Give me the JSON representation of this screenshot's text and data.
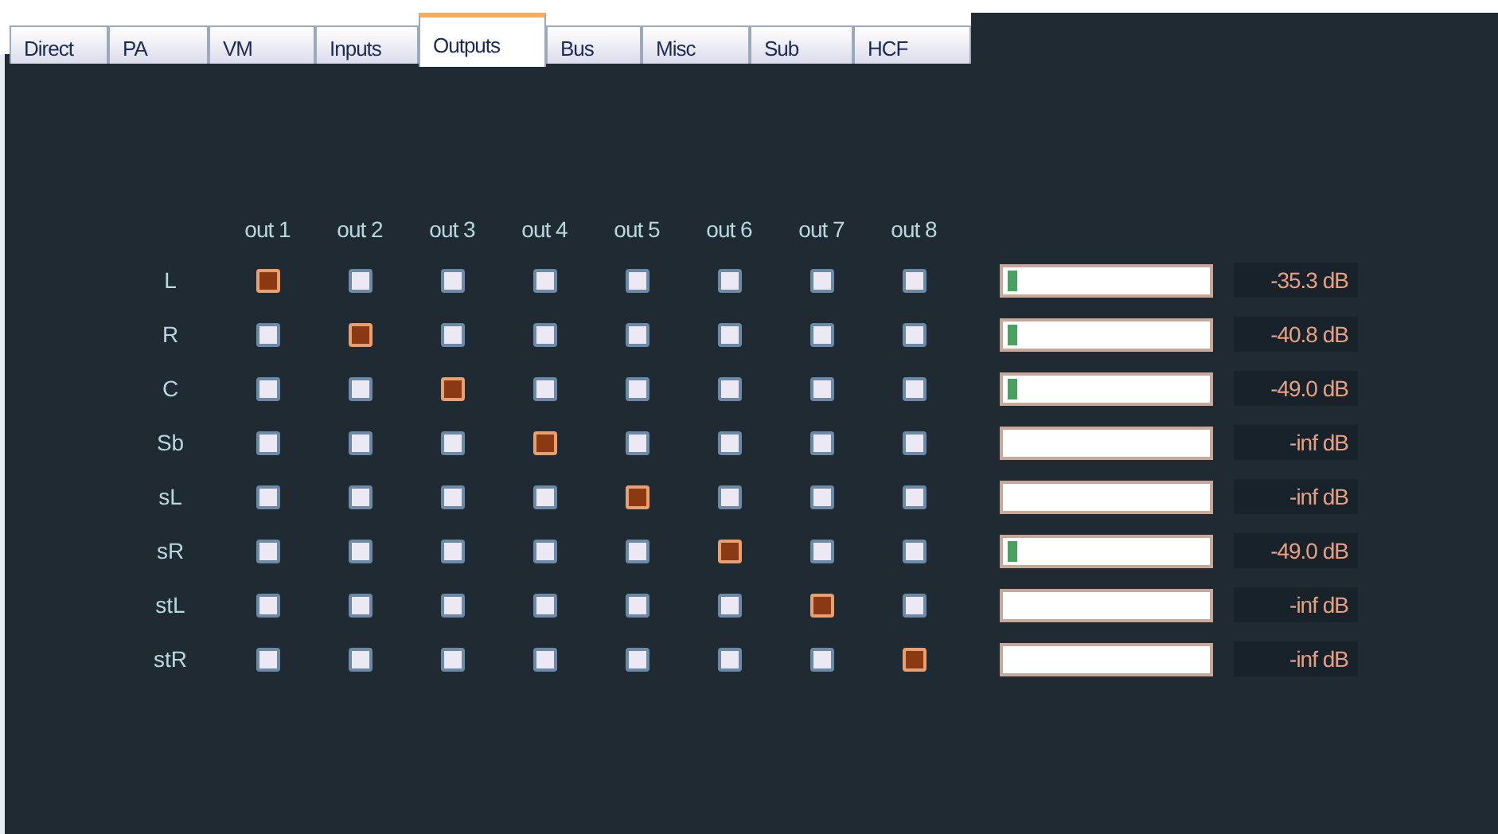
{
  "tabs": [
    {
      "label": "Direct",
      "selected": false
    },
    {
      "label": "PA",
      "selected": false
    },
    {
      "label": "VM",
      "selected": false
    },
    {
      "label": "Inputs",
      "selected": false
    },
    {
      "label": "Outputs",
      "selected": true
    },
    {
      "label": "Bus",
      "selected": false
    },
    {
      "label": "Misc",
      "selected": false
    },
    {
      "label": "Sub",
      "selected": false
    },
    {
      "label": "HCF",
      "selected": false
    }
  ],
  "columns": [
    "out 1",
    "out 2",
    "out 3",
    "out 4",
    "out 5",
    "out 6",
    "out 7",
    "out 8"
  ],
  "rows": [
    {
      "label": "L",
      "routes": [
        {
          "checked": true
        },
        {
          "checked": false
        },
        {
          "checked": false
        },
        {
          "checked": false
        },
        {
          "checked": false
        },
        {
          "checked": false
        },
        {
          "checked": false
        },
        {
          "checked": false
        }
      ],
      "level": 0.05,
      "reading": "-35.3 dB"
    },
    {
      "label": "R",
      "routes": [
        {
          "checked": false
        },
        {
          "checked": true
        },
        {
          "checked": false
        },
        {
          "checked": false
        },
        {
          "checked": false
        },
        {
          "checked": false
        },
        {
          "checked": false
        },
        {
          "checked": false
        }
      ],
      "level": 0.05,
      "reading": "-40.8 dB"
    },
    {
      "label": "C",
      "routes": [
        {
          "checked": false
        },
        {
          "checked": false
        },
        {
          "checked": true
        },
        {
          "checked": false
        },
        {
          "checked": false
        },
        {
          "checked": false
        },
        {
          "checked": false
        },
        {
          "checked": false
        }
      ],
      "level": 0.05,
      "reading": "-49.0 dB"
    },
    {
      "label": "Sb",
      "routes": [
        {
          "checked": false
        },
        {
          "checked": false
        },
        {
          "checked": false
        },
        {
          "checked": true
        },
        {
          "checked": false
        },
        {
          "checked": false
        },
        {
          "checked": false
        },
        {
          "checked": false
        }
      ],
      "reading": "-inf dB"
    },
    {
      "label": "sL",
      "routes": [
        {
          "checked": false
        },
        {
          "checked": false
        },
        {
          "checked": false
        },
        {
          "checked": false
        },
        {
          "checked": true
        },
        {
          "checked": false
        },
        {
          "checked": false
        },
        {
          "checked": false
        }
      ],
      "reading": "-inf dB"
    },
    {
      "label": "sR",
      "routes": [
        {
          "checked": false
        },
        {
          "checked": false
        },
        {
          "checked": false
        },
        {
          "checked": false
        },
        {
          "checked": false
        },
        {
          "checked": true
        },
        {
          "checked": false
        },
        {
          "checked": false
        }
      ],
      "level": 0.05,
      "reading": "-49.0 dB"
    },
    {
      "label": "stL",
      "routes": [
        {
          "checked": false
        },
        {
          "checked": false
        },
        {
          "checked": false
        },
        {
          "checked": false
        },
        {
          "checked": false
        },
        {
          "checked": false
        },
        {
          "checked": true
        },
        {
          "checked": false
        }
      ],
      "reading": "-inf dB"
    },
    {
      "label": "stR",
      "routes": [
        {
          "checked": false
        },
        {
          "checked": false
        },
        {
          "checked": false
        },
        {
          "checked": false
        },
        {
          "checked": false
        },
        {
          "checked": false
        },
        {
          "checked": false
        },
        {
          "checked": true
        }
      ],
      "reading": "-inf dB"
    }
  ]
}
